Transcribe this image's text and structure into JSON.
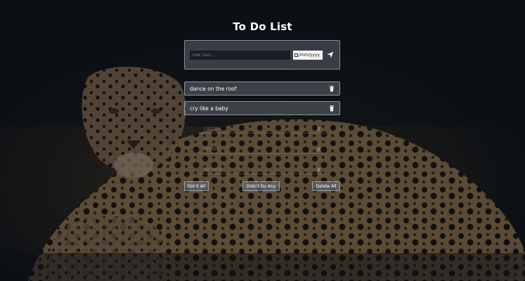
{
  "app": {
    "title": "To Do List"
  },
  "form": {
    "task_placeholder": "new task...",
    "date_placeholder": "/mm/yyyy"
  },
  "todos": [
    {
      "text": "dance on the roof"
    },
    {
      "text": "cry like a baby"
    }
  ],
  "ghost_todos": [
    {
      "text": "run to"
    },
    {
      "text": "create"
    },
    {
      "text": "be nice"
    }
  ],
  "actions": {
    "did_all": "Did It All",
    "didnt_do": "Didn't Do Any",
    "delete_all": "Delete All"
  },
  "colors": {
    "background": "#0c1117",
    "card": "#7a7f89",
    "text": "#ffffff"
  },
  "icons": {
    "send": "paper-plane-icon",
    "delete": "trash-icon",
    "calendar": "calendar-icon"
  }
}
